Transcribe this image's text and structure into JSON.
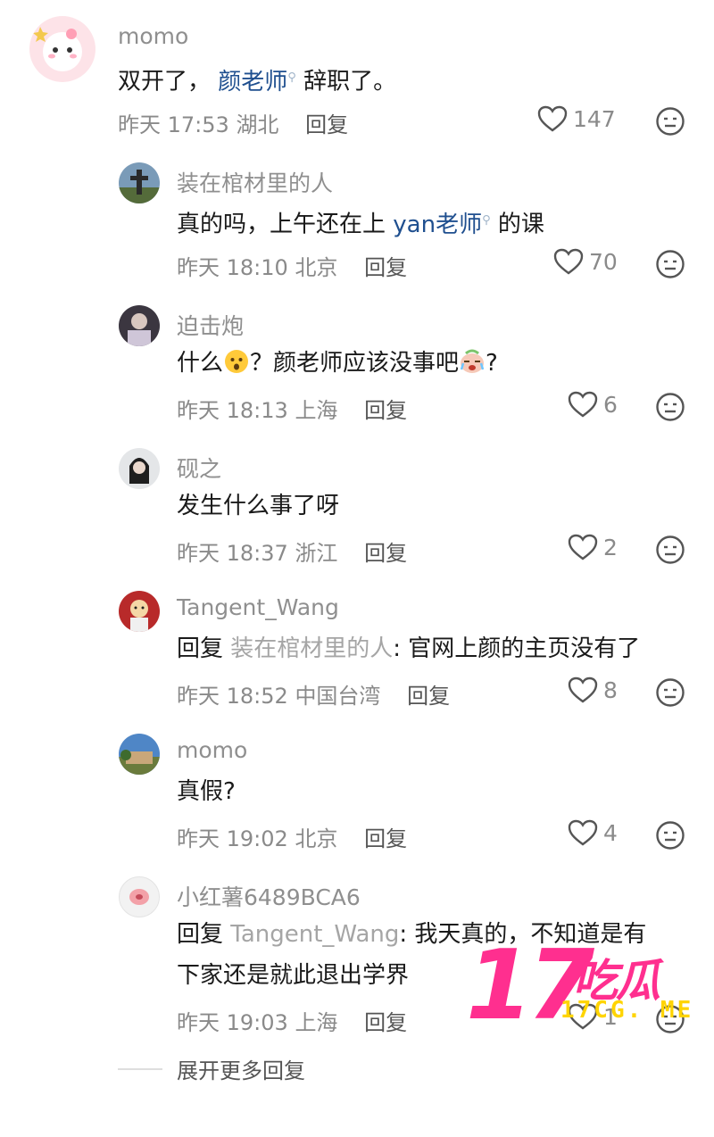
{
  "comments": [
    {
      "name": "momo",
      "text_a": "双开了，",
      "mention": "颜老师",
      "text_b": " 辞职了。",
      "time": "昨天 17:53",
      "loc": "湖北",
      "reply": "回复",
      "likes": "147"
    },
    {
      "name": "装在棺材里的人",
      "text_a": "真的吗，上午还在上 ",
      "mention": "yan老师",
      "text_b": " 的课",
      "time": "昨天 18:10",
      "loc": "北京",
      "reply": "回复",
      "likes": "70"
    },
    {
      "name": "迫击炮",
      "text_a": "什么",
      "text_b": "？颜老师应该没事吧",
      "text_c": "?",
      "time": "昨天 18:13",
      "loc": "上海",
      "reply": "回复",
      "likes": "6"
    },
    {
      "name": "砚之",
      "text": "发生什么事了呀",
      "time": "昨天 18:37",
      "loc": "浙江",
      "reply": "回复",
      "likes": "2"
    },
    {
      "name": "Tangent_Wang",
      "reply_prefix": "回复 ",
      "reply_to": "装在棺材里的人",
      "text": ": 官网上颜的主页没有了",
      "time": "昨天 18:52",
      "loc": "中国台湾",
      "reply": "回复",
      "likes": "8"
    },
    {
      "name": "momo",
      "text": "真假?",
      "time": "昨天 19:02",
      "loc": "北京",
      "reply": "回复",
      "likes": "4"
    },
    {
      "name": "小红薯6489BCA6",
      "reply_prefix": "回复 ",
      "reply_to": "Tangent_Wang",
      "text": ": 我天真的，不知道是有",
      "text_line2": "下家还是就此退出学界",
      "time": "昨天 19:03",
      "loc": "上海",
      "reply": "回复",
      "likes": "1"
    }
  ],
  "expand_label": "展开更多回复",
  "watermark": {
    "big": "17",
    "cn": "吃瓜",
    "url": "17CG. ME"
  },
  "colors": {
    "accent_pink": "#ff2f8f",
    "accent_yellow": "#ffd400",
    "mention": "#1f4f8f"
  }
}
